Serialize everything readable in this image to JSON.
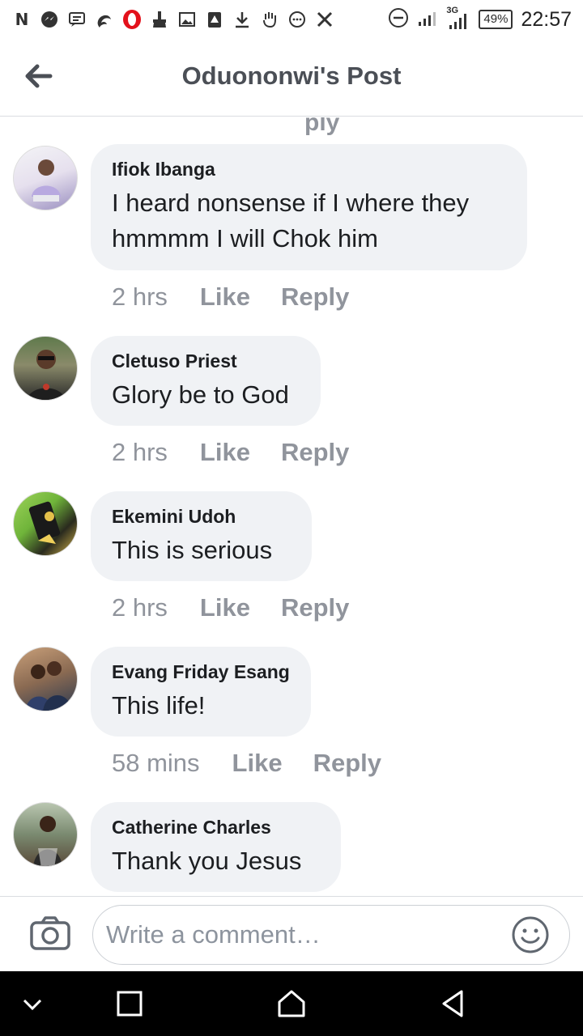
{
  "status_bar": {
    "left_icons": [
      "n-icon",
      "messenger-icon",
      "message-icon",
      "swirl-icon",
      "opera-icon",
      "broom-icon",
      "image-icon",
      "warning-icon",
      "download-icon",
      "hand-icon",
      "chat-icon",
      "x-icon"
    ],
    "network": "3G",
    "battery": "49%",
    "time": "22:57"
  },
  "header": {
    "title": "Oduononwi's Post"
  },
  "comments": [
    {
      "name": "Ifiok Ibanga",
      "text_line1": "I heard nonsense if I where they",
      "text_line2": "hmmmm I will Chok him",
      "time": "2 hrs",
      "like": "Like",
      "reply": "Reply"
    },
    {
      "name": "Cletuso Priest",
      "text_line1": "Glory be to God",
      "time": "2 hrs",
      "like": "Like",
      "reply": "Reply"
    },
    {
      "name": "Ekemini Udoh",
      "text_line1": "This is serious",
      "time": "2 hrs",
      "like": "Like",
      "reply": "Reply"
    },
    {
      "name": "Evang Friday Esang",
      "text_line1": "This life!",
      "time": "58 mins",
      "like": "Like",
      "reply": "Reply"
    },
    {
      "name": "Catherine Charles",
      "text_line1": "Thank you Jesus"
    }
  ],
  "composer": {
    "placeholder": "Write a comment…"
  },
  "colors": {
    "bubble": "#f0f2f5",
    "meta_text": "#90949c",
    "title_text": "#4b4f56",
    "nav_bar": "#000000"
  }
}
